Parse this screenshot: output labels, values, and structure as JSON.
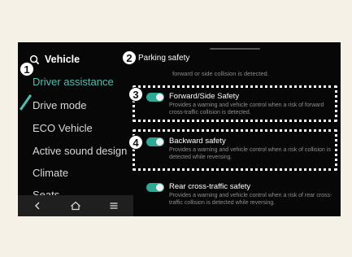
{
  "sidebar": {
    "heading": "Vehicle",
    "items": [
      {
        "label": "Driver assistance"
      },
      {
        "label": "Drive mode"
      },
      {
        "label": "ECO Vehicle"
      },
      {
        "label": "Active sound design"
      },
      {
        "label": "Climate"
      },
      {
        "label": "Seats"
      }
    ],
    "nav": {
      "back_icon": "back-icon",
      "home_icon": "home-icon",
      "menu_icon": "menu-icon"
    }
  },
  "main": {
    "title": "Parking safety",
    "fragment_text": "forward or side collision is detected.",
    "cards": [
      {
        "title": "Forward/Side Safety",
        "description": "Provides a warning and vehicle control when a risk of forward cross-traffic collision is detected.",
        "enabled": true
      },
      {
        "title": "Backward safety",
        "description": "Provides a warning and vehicle control when a risk of collision is detected while reversing.",
        "enabled": true
      },
      {
        "title": "Rear cross-traffic safety",
        "description": "Provides a warning and vehicle control when a risk of rear cross-traffic collision is detected while reversing.",
        "enabled": true
      }
    ]
  },
  "callouts": [
    "1",
    "2",
    "3",
    "4"
  ],
  "colors": {
    "accent": "#4fc0b0",
    "toggle_on": "#2fa896",
    "background": "#070707",
    "page": "#f6f1e6"
  }
}
